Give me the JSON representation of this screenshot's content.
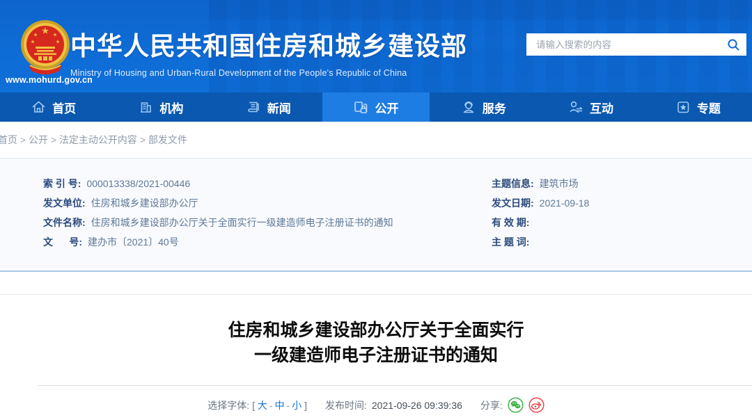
{
  "header": {
    "site_title": "中华人民共和国住房和城乡建设部",
    "site_subtitle": "Ministry of Housing and Urban-Rural Development of the People's Republic of China",
    "site_url": "www.mohurd.gov.cn",
    "search": {
      "placeholder": "请输入搜索的内容",
      "icon": "search-icon"
    }
  },
  "nav": {
    "items": [
      {
        "label": "首页",
        "icon": "home-icon",
        "active": false
      },
      {
        "label": "机构",
        "icon": "building-icon",
        "active": false
      },
      {
        "label": "新闻",
        "icon": "news-icon",
        "active": false
      },
      {
        "label": "公开",
        "icon": "documents-lock-icon",
        "active": true
      },
      {
        "label": "服务",
        "icon": "service-person-icon",
        "active": false
      },
      {
        "label": "互动",
        "icon": "interaction-icon",
        "active": false
      },
      {
        "label": "专题",
        "icon": "star-topic-icon",
        "active": false
      }
    ]
  },
  "breadcrumb": {
    "items": [
      "首页",
      "公开",
      "法定主动公开内容",
      "部发文件"
    ],
    "separator": " > "
  },
  "meta_panel": {
    "left": [
      {
        "label": "索 引 号:",
        "value": "000013338/2021-00446"
      },
      {
        "label": "发文单位:",
        "value": "住房和城乡建设部办公厅"
      },
      {
        "label": "文件名称:",
        "value": "住房和城乡建设部办公厅关于全面实行一级建造师电子注册证书的通知"
      },
      {
        "label": "文      号:",
        "value": "建办市〔2021〕40号"
      }
    ],
    "right": [
      {
        "label": "主题信息:",
        "value": "建筑市场"
      },
      {
        "label": "发文日期:",
        "value": "2021-09-18"
      },
      {
        "label": "有 效 期:",
        "value": ""
      },
      {
        "label": "主 题 词:",
        "value": ""
      }
    ]
  },
  "article": {
    "title_line1": "住房和城乡建设部办公厅关于全面实行",
    "title_line2": "一级建造师电子注册证书的通知"
  },
  "footer": {
    "font_select_label": "选择字体:",
    "bracket_open": "[",
    "bracket_close": "]",
    "font_sizes": {
      "large": "大",
      "medium": "中",
      "small": "小"
    },
    "dash": "-",
    "publish_label": "发布时间:",
    "publish_time": "2021-09-26 09:39:36",
    "share_label": "分享:",
    "share_icons": [
      "wechat-icon",
      "weibo-icon"
    ]
  },
  "colors": {
    "header_blue": "#0e6cd6",
    "nav_blue": "#0a58b0",
    "nav_active_blue": "#1e7de2",
    "panel_bg": "#f8fafd",
    "label_navy": "#2c4a7c",
    "value_blue_gray": "#5e7899",
    "link_blue": "#1472d6",
    "wechat_green": "#3eb347",
    "weibo_red": "#e6484e",
    "emblem_red": "#d6281e",
    "emblem_gold": "#f3c242"
  }
}
